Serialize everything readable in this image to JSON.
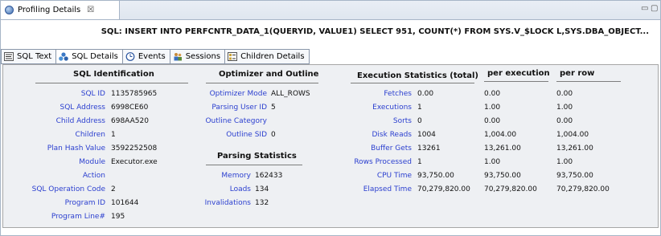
{
  "view": {
    "tab_title": "Profiling Details",
    "close_glyph": "☒",
    "minimize_glyph": "▭",
    "maximize_glyph": "▢",
    "icon": "profiling-icon"
  },
  "sql_header": "SQL: INSERT INTO PERFCNTR_DATA_1(QUERYID, VALUE1) SELECT 951, COUNT(*) FROM SYS.V_$LOCK L,SYS.DBA_OBJECT...",
  "subtabs": [
    {
      "label": "SQL Text",
      "icon": "sql-text-icon"
    },
    {
      "label": "SQL Details",
      "icon": "sql-details-icon"
    },
    {
      "label": "Events",
      "icon": "events-icon"
    },
    {
      "label": "Sessions",
      "icon": "sessions-icon"
    },
    {
      "label": "Children Details",
      "icon": "children-details-icon"
    }
  ],
  "sql_identification": {
    "header": "SQL Identification",
    "rows": [
      {
        "label": "SQL ID",
        "value": "1135785965"
      },
      {
        "label": "SQL Address",
        "value": "6998CE60"
      },
      {
        "label": "Child Address",
        "value": "698AA520"
      },
      {
        "label": "Children",
        "value": "1"
      },
      {
        "label": "Plan Hash Value",
        "value": "3592252508"
      },
      {
        "label": "Module",
        "value": "Executor.exe"
      },
      {
        "label": "Action",
        "value": ""
      },
      {
        "label": "SQL Operation Code",
        "value": "2"
      },
      {
        "label": "Program ID",
        "value": "101644"
      },
      {
        "label": "Program Line#",
        "value": "195"
      }
    ]
  },
  "optimizer_outline": {
    "header": "Optimizer and Outline",
    "rows": [
      {
        "label": "Optimizer Mode",
        "value": "ALL_ROWS"
      },
      {
        "label": "Parsing User ID",
        "value": "5"
      },
      {
        "label": "Outline Category",
        "value": ""
      },
      {
        "label": "Outline SID",
        "value": "0"
      }
    ]
  },
  "parsing_statistics": {
    "header": "Parsing Statistics",
    "rows": [
      {
        "label": "Memory",
        "value": "162433"
      },
      {
        "label": "Loads",
        "value": "134"
      },
      {
        "label": "Invalidations",
        "value": "132"
      }
    ]
  },
  "execution_statistics": {
    "header": "Execution Statistics (total)",
    "col_per_execution": "per execution",
    "col_per_row": "per row",
    "rows": [
      {
        "label": "Fetches",
        "total": "0.00",
        "per_exec": "0.00",
        "per_row": "0.00"
      },
      {
        "label": "Executions",
        "total": "1",
        "per_exec": "1.00",
        "per_row": "1.00"
      },
      {
        "label": "Sorts",
        "total": "0",
        "per_exec": "0.00",
        "per_row": "0.00"
      },
      {
        "label": "Disk Reads",
        "total": "1004",
        "per_exec": "1,004.00",
        "per_row": "1,004.00"
      },
      {
        "label": "Buffer Gets",
        "total": "13261",
        "per_exec": "13,261.00",
        "per_row": "13,261.00"
      },
      {
        "label": "Rows Processed",
        "total": "1",
        "per_exec": "1.00",
        "per_row": "1.00"
      },
      {
        "label": "CPU Time",
        "total": "93,750.00",
        "per_exec": "93,750.00",
        "per_row": "93,750.00"
      },
      {
        "label": "Elapsed Time",
        "total": "70,279,820.00",
        "per_exec": "70,279,820.00",
        "per_row": "70,279,820.00"
      }
    ]
  }
}
